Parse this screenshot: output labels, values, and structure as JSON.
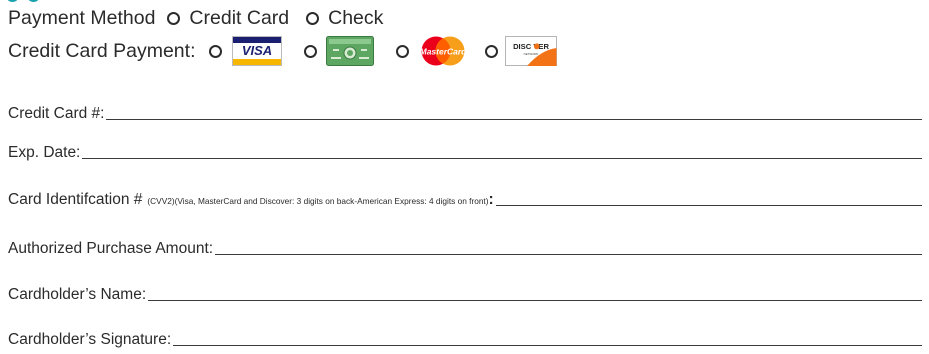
{
  "payment_method": {
    "label": "Payment Method",
    "options": [
      "Credit Card",
      "Check"
    ]
  },
  "credit_card_payment": {
    "label": "Credit Card Payment:",
    "cards": [
      {
        "icon": "visa-logo",
        "text": "VISA",
        "colors": {
          "band_top": "#1a1f71",
          "band_bottom": "#f7b600"
        }
      },
      {
        "icon": "american-express-logo",
        "text": "",
        "colors": {
          "fill": "#5ea763"
        }
      },
      {
        "icon": "mastercard-logo",
        "text": "MasterCard",
        "colors": {
          "red": "#eb001b",
          "orange": "#f79e1b"
        }
      },
      {
        "icon": "discover-logo",
        "text": "DISC VER",
        "subtext": "NETWORK",
        "colors": {
          "orange": "#f47216"
        }
      }
    ]
  },
  "fields": {
    "credit_card_number": "Credit Card #:",
    "exp_date": "Exp. Date:",
    "card_identification": "Card Identifcation #",
    "card_identification_note": "(CVV2)(Visa, MasterCard and Discover: 3 digits on back-American Express: 4 digits on front)",
    "card_identification_colon": ":",
    "authorized_amount": "Authorized Purchase Amount:",
    "cardholder_name": "Cardholder’s Name:",
    "cardholder_signature": "Cardholder’s Signature:"
  }
}
